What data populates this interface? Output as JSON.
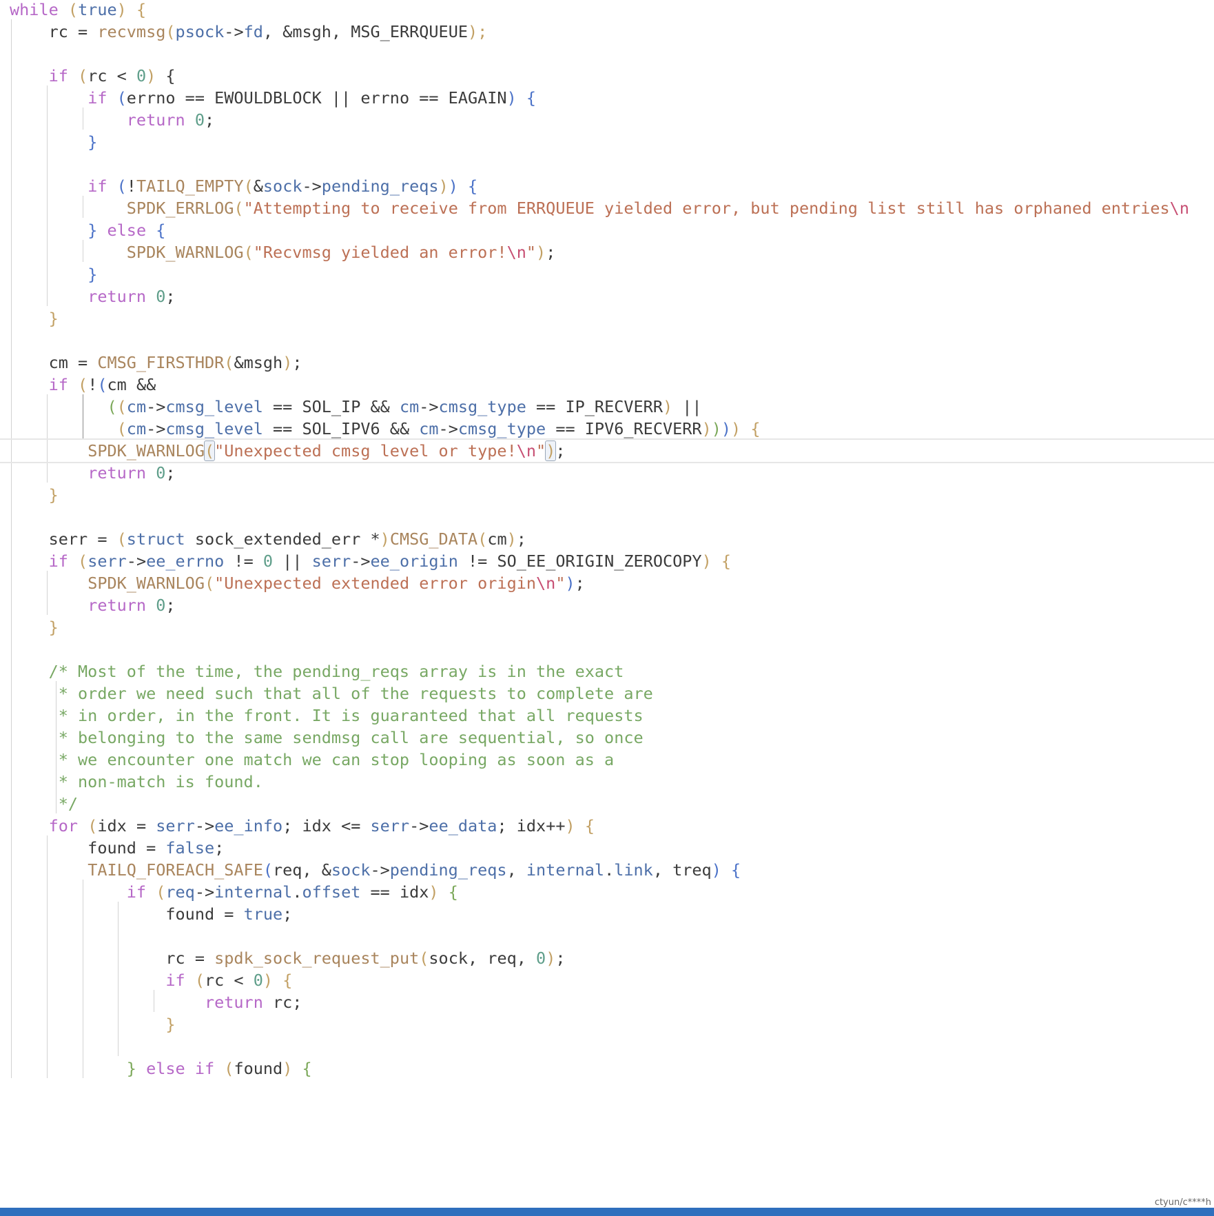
{
  "palette": {
    "default": "#3b3b3b",
    "keyword": "#b668c7",
    "func": "#a9855d",
    "member": "#4d6fa8",
    "number": "#5f9e8a",
    "string": "#bc7055",
    "escape": "#c74f73",
    "comment": "#78a864",
    "paren": "#c2a064",
    "brace": "#c2a064",
    "brace_blue": "#4b72c8",
    "brace_green": "#7ba859"
  },
  "editor": {
    "lines": [
      [
        [
          "while",
          "keyword"
        ],
        [
          " ",
          ""
        ],
        [
          "(",
          "paren"
        ],
        [
          "true",
          "member"
        ],
        [
          ")",
          "paren"
        ],
        [
          " {",
          "brace"
        ]
      ],
      [
        [
          "    rc = ",
          ""
        ],
        [
          "recvmsg",
          "func"
        ],
        [
          "(",
          "paren"
        ],
        [
          "psock",
          "member"
        ],
        [
          "->",
          ""
        ],
        [
          "fd",
          "member"
        ],
        [
          ", &msgh, MSG_ERRQUEUE",
          ""
        ],
        [
          ");",
          "paren"
        ]
      ],
      [
        [
          "",
          ""
        ]
      ],
      [
        [
          "    ",
          ""
        ],
        [
          "if",
          "keyword"
        ],
        [
          " ",
          ""
        ],
        [
          "(",
          "paren"
        ],
        [
          "rc < ",
          ""
        ],
        [
          "0",
          "number"
        ],
        [
          ")",
          "paren"
        ],
        [
          " {",
          ""
        ]
      ],
      [
        [
          "        ",
          ""
        ],
        [
          "if",
          "keyword"
        ],
        [
          " ",
          ""
        ],
        [
          "(",
          "brace_blue"
        ],
        [
          "errno == EWOULDBLOCK || errno == EAGAIN",
          ""
        ],
        [
          ")",
          "brace_blue"
        ],
        [
          " ",
          ""
        ],
        [
          "{",
          "brace_blue"
        ]
      ],
      [
        [
          "            ",
          ""
        ],
        [
          "return",
          "keyword"
        ],
        [
          " ",
          ""
        ],
        [
          "0",
          "number"
        ],
        [
          ";",
          ""
        ]
      ],
      [
        [
          "        ",
          ""
        ],
        [
          "}",
          "brace_blue"
        ]
      ],
      [
        [
          "",
          ""
        ]
      ],
      [
        [
          "        ",
          ""
        ],
        [
          "if",
          "keyword"
        ],
        [
          " ",
          ""
        ],
        [
          "(",
          "brace_blue"
        ],
        [
          "!",
          ""
        ],
        [
          "TAILQ_EMPTY",
          "func"
        ],
        [
          "(",
          "paren"
        ],
        [
          "&",
          ""
        ],
        [
          "sock",
          "member"
        ],
        [
          "->",
          ""
        ],
        [
          "pending_reqs",
          "member"
        ],
        [
          ")",
          "paren"
        ],
        [
          ")",
          "brace_blue"
        ],
        [
          " ",
          ""
        ],
        [
          "{",
          "brace_blue"
        ]
      ],
      [
        [
          "            ",
          ""
        ],
        [
          "SPDK_ERRLOG",
          "func"
        ],
        [
          "(",
          "paren"
        ],
        [
          "\"Attempting to receive from ERRQUEUE yielded error, but pending list still has orphaned entries",
          "string"
        ],
        [
          "\\n",
          "escape"
        ]
      ],
      [
        [
          "        ",
          ""
        ],
        [
          "}",
          "brace_blue"
        ],
        [
          " ",
          ""
        ],
        [
          "else",
          "keyword"
        ],
        [
          " ",
          ""
        ],
        [
          "{",
          "brace_blue"
        ]
      ],
      [
        [
          "            ",
          ""
        ],
        [
          "SPDK_WARNLOG",
          "func"
        ],
        [
          "(",
          "paren"
        ],
        [
          "\"Recvmsg yielded an error!",
          "string"
        ],
        [
          "\\n",
          "escape"
        ],
        [
          "\"",
          "string"
        ],
        [
          ")",
          "paren"
        ],
        [
          ";",
          ""
        ]
      ],
      [
        [
          "        ",
          ""
        ],
        [
          "}",
          "brace_blue"
        ]
      ],
      [
        [
          "        ",
          ""
        ],
        [
          "return",
          "keyword"
        ],
        [
          " ",
          ""
        ],
        [
          "0",
          "number"
        ],
        [
          ";",
          ""
        ]
      ],
      [
        [
          "    ",
          ""
        ],
        [
          "}",
          "brace"
        ]
      ],
      [
        [
          "",
          ""
        ]
      ],
      [
        [
          "    cm = ",
          ""
        ],
        [
          "CMSG_FIRSTHDR",
          "func"
        ],
        [
          "(",
          "paren"
        ],
        [
          "&msgh",
          ""
        ],
        [
          ")",
          "paren"
        ],
        [
          ";",
          ""
        ]
      ],
      [
        [
          "    ",
          ""
        ],
        [
          "if",
          "keyword"
        ],
        [
          " ",
          ""
        ],
        [
          "(",
          "paren"
        ],
        [
          "!",
          ""
        ],
        [
          "(",
          "brace_blue"
        ],
        [
          "cm &&",
          ""
        ]
      ],
      [
        [
          "          ",
          ""
        ],
        [
          "(",
          "brace_green"
        ],
        [
          "(",
          "paren"
        ],
        [
          "cm",
          "member"
        ],
        [
          "->",
          ""
        ],
        [
          "cmsg_level",
          "member"
        ],
        [
          " == SOL_IP && ",
          ""
        ],
        [
          "cm",
          "member"
        ],
        [
          "->",
          ""
        ],
        [
          "cmsg_type",
          "member"
        ],
        [
          " == IP_RECVERR",
          ""
        ],
        [
          ")",
          "paren"
        ],
        [
          " ||",
          ""
        ]
      ],
      [
        [
          "           ",
          ""
        ],
        [
          "(",
          "paren"
        ],
        [
          "cm",
          "member"
        ],
        [
          "->",
          ""
        ],
        [
          "cmsg_level",
          "member"
        ],
        [
          " == SOL_IPV6 && ",
          ""
        ],
        [
          "cm",
          "member"
        ],
        [
          "->",
          ""
        ],
        [
          "cmsg_type",
          "member"
        ],
        [
          " == IPV6_RECVERR",
          ""
        ],
        [
          ")",
          "paren"
        ],
        [
          ")",
          "brace_green"
        ],
        [
          ")",
          "brace_blue"
        ],
        [
          ")",
          "paren"
        ],
        [
          " {",
          "brace"
        ]
      ],
      [
        [
          "        ",
          ""
        ],
        [
          "SPDK_WARNLOG",
          "func"
        ],
        [
          "(",
          "paren bm"
        ],
        [
          "\"Unexpected cmsg level or type!",
          "string"
        ],
        [
          "\\n",
          "escape"
        ],
        [
          "\"",
          "string"
        ],
        [
          ")",
          "paren bm"
        ],
        [
          ";",
          ""
        ]
      ],
      [
        [
          "        ",
          ""
        ],
        [
          "return",
          "keyword"
        ],
        [
          " ",
          ""
        ],
        [
          "0",
          "number"
        ],
        [
          ";",
          ""
        ]
      ],
      [
        [
          "    ",
          ""
        ],
        [
          "}",
          "brace"
        ]
      ],
      [
        [
          "",
          ""
        ]
      ],
      [
        [
          "    serr = ",
          ""
        ],
        [
          "(",
          "paren"
        ],
        [
          "struct",
          "member"
        ],
        [
          " sock_extended_err *",
          ""
        ],
        [
          ")",
          "paren"
        ],
        [
          "CMSG_DATA",
          "func"
        ],
        [
          "(",
          "paren"
        ],
        [
          "cm",
          ""
        ],
        [
          ")",
          "paren"
        ],
        [
          ";",
          ""
        ]
      ],
      [
        [
          "    ",
          ""
        ],
        [
          "if",
          "keyword"
        ],
        [
          " ",
          ""
        ],
        [
          "(",
          "paren"
        ],
        [
          "serr",
          "member"
        ],
        [
          "->",
          ""
        ],
        [
          "ee_errno",
          "member"
        ],
        [
          " != ",
          ""
        ],
        [
          "0",
          "number"
        ],
        [
          " || ",
          ""
        ],
        [
          "serr",
          "member"
        ],
        [
          "->",
          ""
        ],
        [
          "ee_origin",
          "member"
        ],
        [
          " != SO_EE_ORIGIN_ZEROCOPY",
          ""
        ],
        [
          ")",
          "paren"
        ],
        [
          " {",
          "brace"
        ]
      ],
      [
        [
          "        ",
          ""
        ],
        [
          "SPDK_WARNLOG",
          "func"
        ],
        [
          "(",
          "paren"
        ],
        [
          "\"Unexpected extended error origin",
          "string"
        ],
        [
          "\\n",
          "escape"
        ],
        [
          "\"",
          "string"
        ],
        [
          ")",
          "brace_blue"
        ],
        [
          ";",
          ""
        ]
      ],
      [
        [
          "        ",
          ""
        ],
        [
          "return",
          "keyword"
        ],
        [
          " ",
          ""
        ],
        [
          "0",
          "number"
        ],
        [
          ";",
          ""
        ]
      ],
      [
        [
          "    ",
          ""
        ],
        [
          "}",
          "brace"
        ]
      ],
      [
        [
          "",
          ""
        ]
      ],
      [
        [
          "    /* Most of the time, the pending_reqs array is in the exact",
          "comment"
        ]
      ],
      [
        [
          "     * order we need such that all of the requests to complete are",
          "comment"
        ]
      ],
      [
        [
          "     * in order, in the front. It is guaranteed that all requests",
          "comment"
        ]
      ],
      [
        [
          "     * belonging to the same sendmsg call are sequential, so once",
          "comment"
        ]
      ],
      [
        [
          "     * we encounter one match we can stop looping as soon as a",
          "comment"
        ]
      ],
      [
        [
          "     * non-match is found.",
          "comment"
        ]
      ],
      [
        [
          "     */",
          "comment"
        ]
      ],
      [
        [
          "    ",
          ""
        ],
        [
          "for",
          "keyword"
        ],
        [
          " ",
          ""
        ],
        [
          "(",
          "paren"
        ],
        [
          "idx = ",
          ""
        ],
        [
          "serr",
          "member"
        ],
        [
          "->",
          ""
        ],
        [
          "ee_info",
          "member"
        ],
        [
          "; idx <= ",
          ""
        ],
        [
          "serr",
          "member"
        ],
        [
          "->",
          ""
        ],
        [
          "ee_data",
          "member"
        ],
        [
          "; idx++",
          ""
        ],
        [
          ")",
          "paren"
        ],
        [
          " {",
          "brace"
        ]
      ],
      [
        [
          "        found = ",
          ""
        ],
        [
          "false",
          "member"
        ],
        [
          ";",
          ""
        ]
      ],
      [
        [
          "        ",
          ""
        ],
        [
          "TAILQ_FOREACH_SAFE",
          "func"
        ],
        [
          "(",
          "brace_blue"
        ],
        [
          "req, &",
          ""
        ],
        [
          "sock",
          "member"
        ],
        [
          "->",
          ""
        ],
        [
          "pending_reqs",
          "member"
        ],
        [
          ", ",
          ""
        ],
        [
          "internal",
          "member"
        ],
        [
          ".",
          ""
        ],
        [
          "link",
          "member"
        ],
        [
          ", treq",
          ""
        ],
        [
          ")",
          "brace_blue"
        ],
        [
          " ",
          ""
        ],
        [
          "{",
          "brace_blue"
        ]
      ],
      [
        [
          "            ",
          ""
        ],
        [
          "if",
          "keyword"
        ],
        [
          " ",
          ""
        ],
        [
          "(",
          "paren"
        ],
        [
          "req",
          "member"
        ],
        [
          "->",
          ""
        ],
        [
          "internal",
          "member"
        ],
        [
          ".",
          ""
        ],
        [
          "offset",
          "member"
        ],
        [
          " == idx",
          ""
        ],
        [
          ")",
          "paren"
        ],
        [
          " ",
          ""
        ],
        [
          "{",
          "brace_green"
        ]
      ],
      [
        [
          "                found = ",
          ""
        ],
        [
          "true",
          "member"
        ],
        [
          ";",
          ""
        ]
      ],
      [
        [
          "",
          ""
        ]
      ],
      [
        [
          "                rc = ",
          ""
        ],
        [
          "spdk_sock_request_put",
          "func"
        ],
        [
          "(",
          "paren"
        ],
        [
          "sock, req, ",
          ""
        ],
        [
          "0",
          "number"
        ],
        [
          ")",
          "paren"
        ],
        [
          ";",
          ""
        ]
      ],
      [
        [
          "                ",
          ""
        ],
        [
          "if",
          "keyword"
        ],
        [
          " ",
          ""
        ],
        [
          "(",
          "paren"
        ],
        [
          "rc < ",
          ""
        ],
        [
          "0",
          "number"
        ],
        [
          ")",
          "paren"
        ],
        [
          " {",
          "brace"
        ]
      ],
      [
        [
          "                    ",
          ""
        ],
        [
          "return",
          "keyword"
        ],
        [
          " rc;",
          ""
        ]
      ],
      [
        [
          "                ",
          ""
        ],
        [
          "}",
          "brace"
        ]
      ],
      [
        [
          "",
          ""
        ]
      ],
      [
        [
          "            ",
          ""
        ],
        [
          "}",
          "brace_green"
        ],
        [
          " ",
          ""
        ],
        [
          "else",
          "keyword"
        ],
        [
          " ",
          ""
        ],
        [
          "if",
          "keyword"
        ],
        [
          " ",
          ""
        ],
        [
          "(",
          "paren"
        ],
        [
          "found",
          ""
        ],
        [
          ")",
          "paren"
        ],
        [
          " ",
          ""
        ],
        [
          "{",
          "brace_green"
        ]
      ]
    ]
  },
  "footer": {
    "watermark": "ctyun/c****h"
  }
}
